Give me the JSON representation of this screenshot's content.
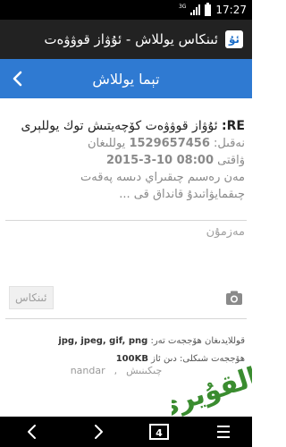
{
  "status_bar": {
    "network": "3G",
    "time": "17:27"
  },
  "title_bar": {
    "title": "ئىنكاس يوللاش - ئۇۋاز قوۋۋەت",
    "logo_text": "ئۇ"
  },
  "nav_bar": {
    "title": "تېما يوللاش"
  },
  "message": {
    "subject_prefix": "RE:",
    "subject_text": " ئۇۋاز قوۋۋەت كۆچەيتىش توك يوللېرى",
    "posted_label": "نەقىل:",
    "posted_value": "1529657456",
    "posted_suffix": "يوللىغان",
    "time_label": "ۋاقتى",
    "time_value": "2015-3-10 08:00",
    "body_line1": "مەن رەسىم چىقىراي دىسە پەقەت",
    "body_line2": "چىقمايۋاتىدۇ   قانداق قى ..."
  },
  "content_field": {
    "placeholder": "مەزمۇن"
  },
  "attach_button": {
    "label": "ئىنكاس"
  },
  "upload_info": {
    "types_label": "قوللايدىغان ھۆججەت تەر:",
    "types_value": "jpg, jpeg, gif, png",
    "size_label": "ھۆججەت شىكلى: دىن ئاز",
    "size_value": "100KB"
  },
  "faded_row": {
    "item1": "چىكىنىش",
    "item2": "nandar"
  },
  "watermark": {
    "text": "ئالقۇيرى"
  },
  "bottom_nav": {
    "badge": "4"
  },
  "colors": {
    "accent": "#2f7ad2",
    "watermark": "#3a8c2f"
  }
}
